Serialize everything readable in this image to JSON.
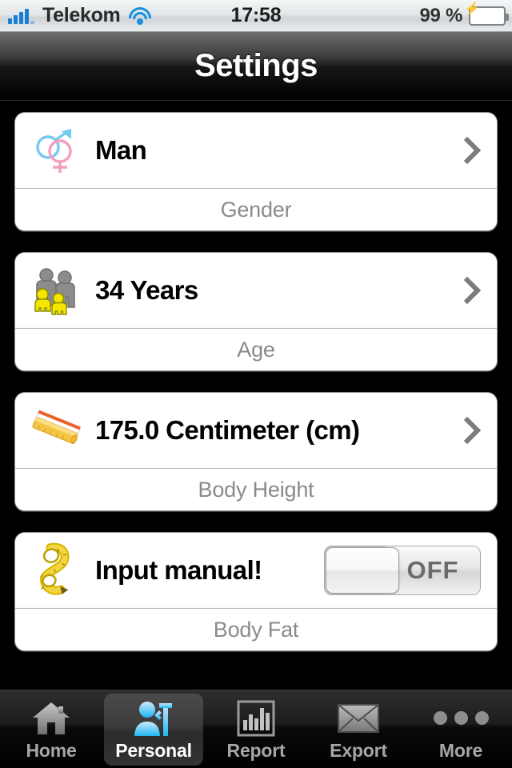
{
  "status_bar": {
    "signal_icon": "signal-bars-icon",
    "carrier": "Telekom",
    "wifi_icon": "wifi-icon",
    "time": "17:58",
    "battery_percent": "99 %",
    "battery_icon": "battery-charging-icon",
    "accent_color": "#1a8fe0"
  },
  "navbar": {
    "title": "Settings"
  },
  "settings": {
    "items": [
      {
        "icon": "gender-symbols-icon",
        "value": "Man",
        "label": "Gender",
        "accessory": "chevron-right-icon",
        "type": "disclosure"
      },
      {
        "icon": "family-group-icon",
        "value": "34 Years",
        "label": "Age",
        "accessory": "chevron-right-icon",
        "type": "disclosure"
      },
      {
        "icon": "ruler-icon",
        "value": "175.0 Centimeter (cm)",
        "label": "Body Height",
        "accessory": "chevron-right-icon",
        "type": "disclosure"
      },
      {
        "icon": "measuring-tape-icon",
        "value": "Input manual!",
        "label": "Body Fat",
        "accessory": "toggle-switch",
        "type": "toggle",
        "toggle_state": "OFF"
      }
    ]
  },
  "tabbar": {
    "items": [
      {
        "label": "Home",
        "icon": "house-icon",
        "selected": false
      },
      {
        "label": "Personal",
        "icon": "person-tools-icon",
        "selected": true
      },
      {
        "label": "Report",
        "icon": "bar-chart-icon",
        "selected": false
      },
      {
        "label": "Export",
        "icon": "envelope-icon",
        "selected": false
      },
      {
        "label": "More",
        "icon": "ellipsis-icon",
        "selected": false
      }
    ]
  },
  "colors": {
    "background": "#000000",
    "card_background": "#ffffff",
    "label_gray": "#8a8a8a",
    "selected_tab_blue": "#4ab8f0"
  }
}
